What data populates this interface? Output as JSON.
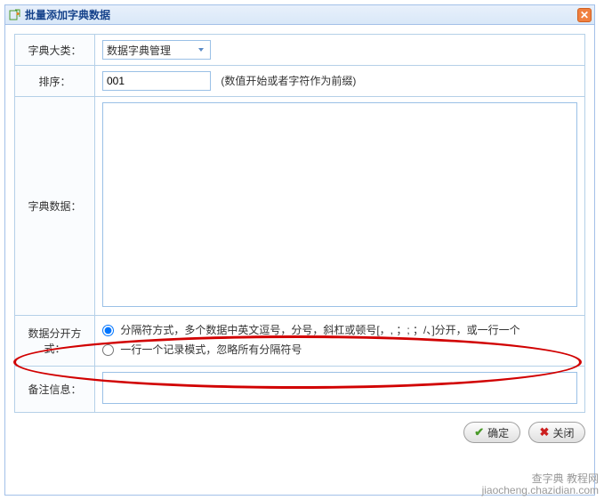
{
  "dialog": {
    "title": "批量添加字典数据"
  },
  "form": {
    "category_label": "字典大类：",
    "category_value": "数据字典管理",
    "sort_label": "排序：",
    "sort_value": "001",
    "sort_hint": "(数值开始或者字符作为前缀)",
    "data_label": "字典数据：",
    "data_value": "",
    "split_label": "数据分开方式：",
    "split_option1": "分隔符方式，多个数据中英文逗号，分号，斜杠或顿号[，, ；; ；/、]分开，或一行一个",
    "split_option2": "一行一个记录模式，忽略所有分隔符号",
    "remark_label": "备注信息：",
    "remark_value": ""
  },
  "buttons": {
    "ok": "确定",
    "cancel": "关闭"
  },
  "watermark": {
    "line1": "查字典 教程网",
    "line2": "jiaocheng.chazidian.com"
  }
}
